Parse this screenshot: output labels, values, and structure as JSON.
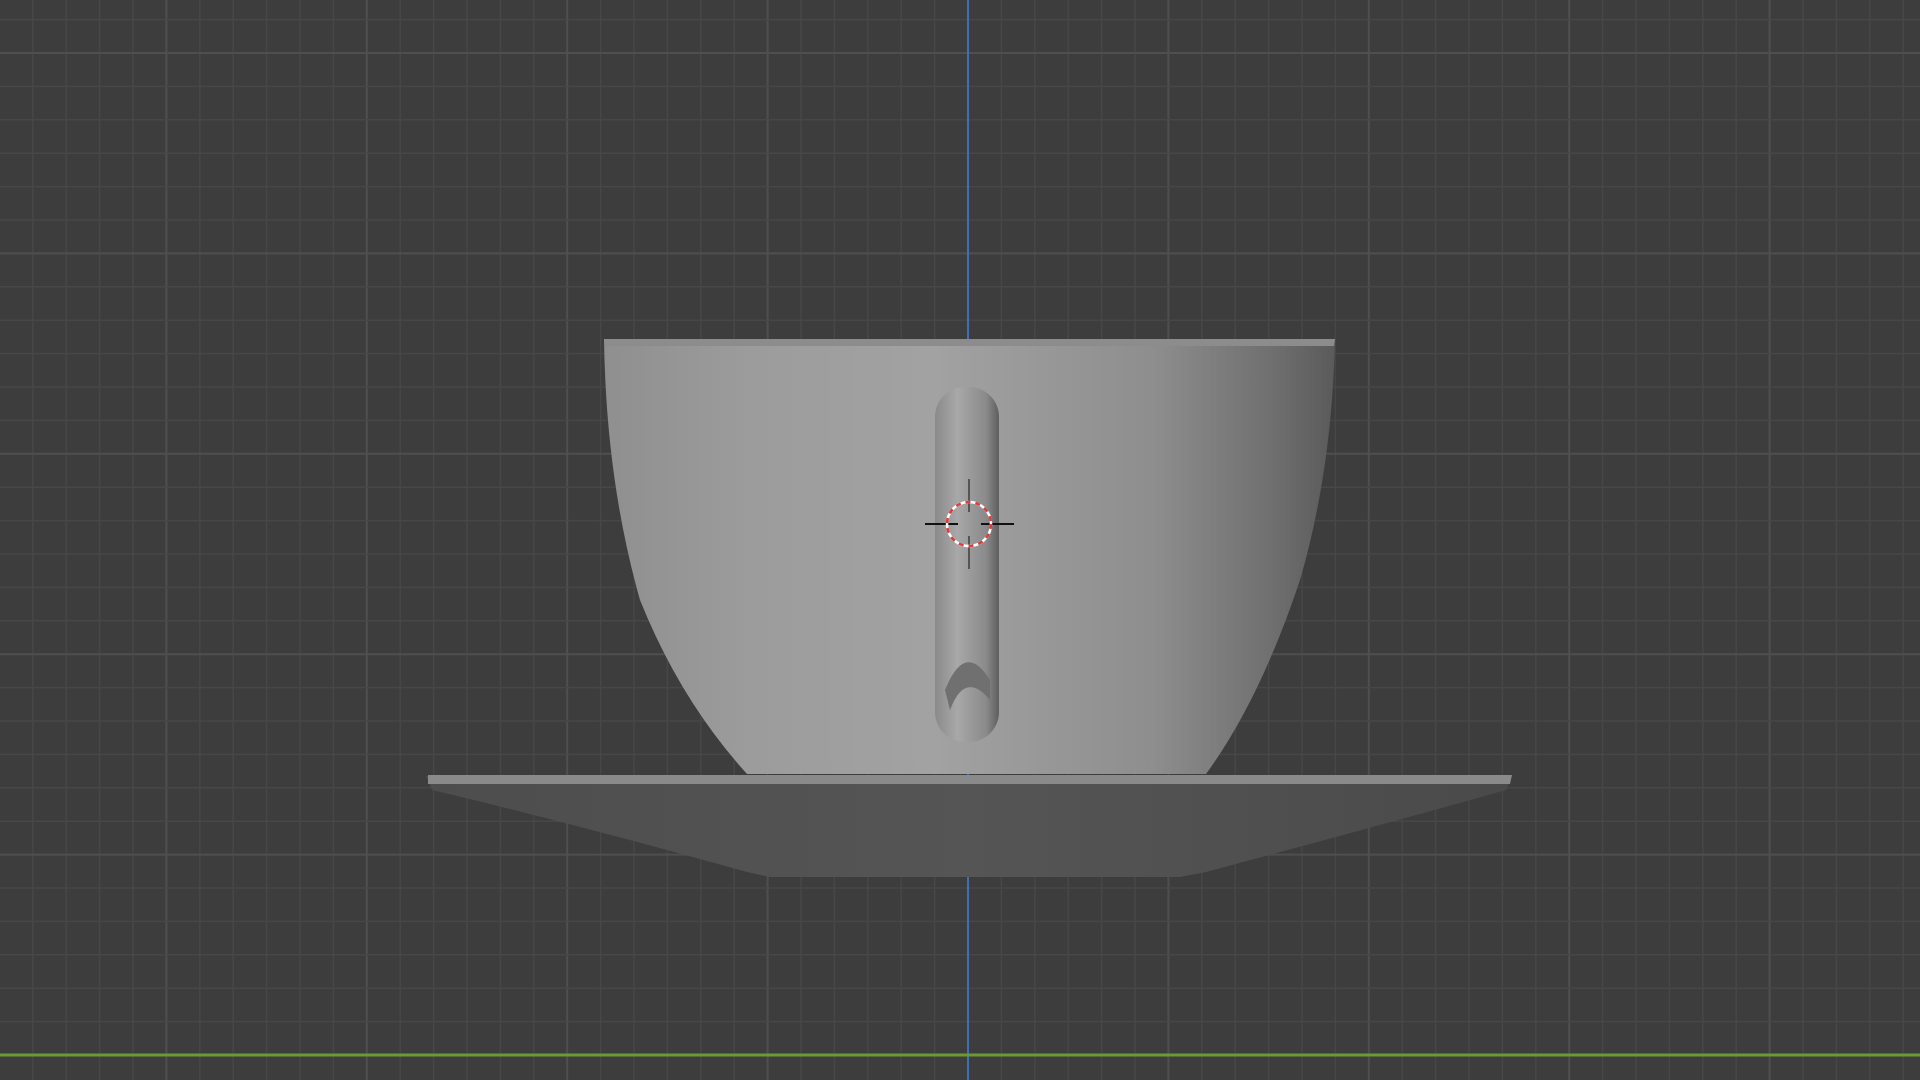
{
  "viewport": {
    "background_color": "#3d3d3d",
    "grid_minor_color": "#474747",
    "grid_major_color": "#4f4f4f",
    "axis_z_color": "#3f6fb8",
    "axis_y_color": "#6a9a32"
  },
  "scene": {
    "objects": [
      "cup",
      "saucer"
    ],
    "cursor_icon": "3d-cursor-icon"
  }
}
